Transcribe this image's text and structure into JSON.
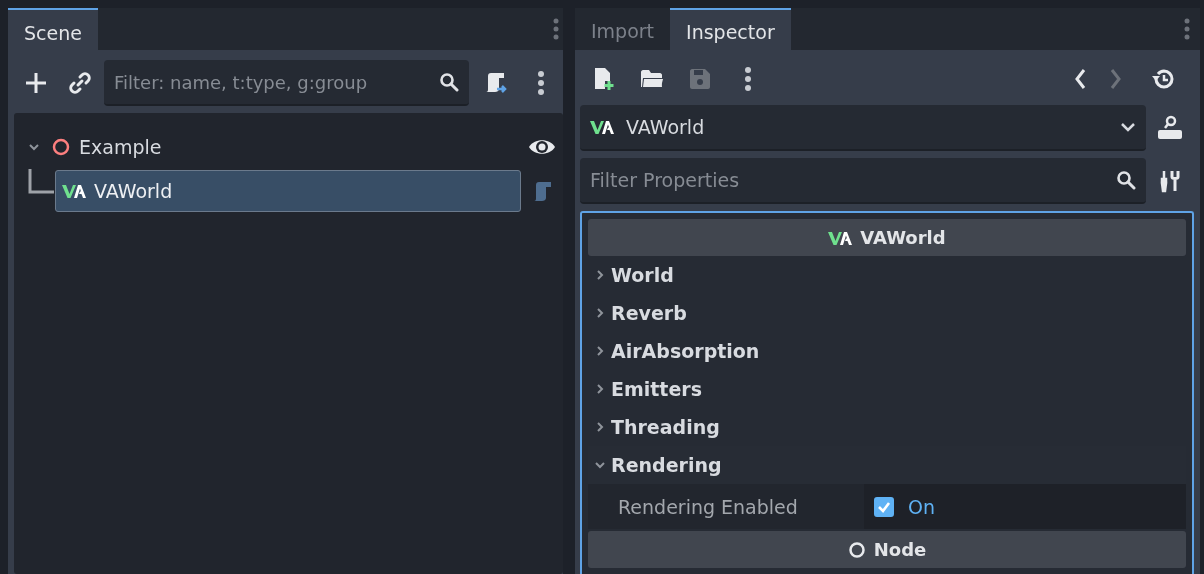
{
  "scene_dock": {
    "tabs": [
      {
        "label": "Scene",
        "selected": true
      }
    ],
    "filter": {
      "placeholder": "Filter: name, t:type, g:group"
    },
    "tree": [
      {
        "name": "Example",
        "kind": "node",
        "expanded": true,
        "selected": false,
        "children": [
          {
            "name": "VAWorld",
            "kind": "vaworld",
            "selected": true
          }
        ]
      }
    ]
  },
  "inspector_dock": {
    "tabs": [
      {
        "label": "Import",
        "selected": false
      },
      {
        "label": "Inspector",
        "selected": true
      }
    ],
    "toolbar": [
      {
        "kind": "new",
        "disabled": false
      },
      {
        "kind": "open",
        "disabled": false
      },
      {
        "kind": "save",
        "disabled": true
      },
      {
        "kind": "menu"
      },
      {
        "kind": "back",
        "disabled": false
      },
      {
        "kind": "forward",
        "disabled": true
      },
      {
        "kind": "history",
        "disabled": false
      }
    ],
    "object_selector": {
      "value": "VAWorld"
    },
    "filter": {
      "placeholder": "Filter Properties"
    },
    "class_header": "VAWorld",
    "sections": [
      {
        "label": "World",
        "expanded": false
      },
      {
        "label": "Reverb",
        "expanded": false
      },
      {
        "label": "AirAbsorption",
        "expanded": false
      },
      {
        "label": "Emitters",
        "expanded": false
      },
      {
        "label": "Threading",
        "expanded": false
      },
      {
        "label": "Rendering",
        "expanded": true,
        "properties": [
          {
            "label": "Rendering Enabled",
            "checked": true,
            "value": "On"
          }
        ]
      }
    ],
    "node_header": "Node"
  }
}
